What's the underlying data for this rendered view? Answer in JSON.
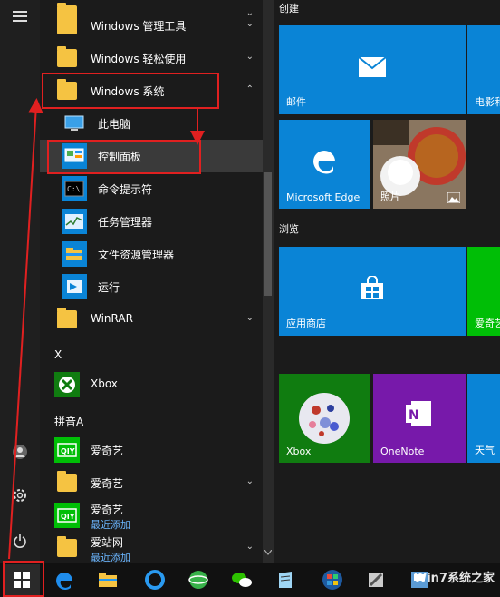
{
  "sections": {
    "x": "X",
    "pinyin_a": "拼音A"
  },
  "apps": {
    "windows_admin_tools": "Windows 管理工具",
    "windows_ease_of_access": "Windows 轻松使用",
    "windows_system": "Windows 系统",
    "this_pc": "此电脑",
    "control_panel": "控制面板",
    "command_prompt": "命令提示符",
    "task_manager": "任务管理器",
    "file_explorer": "文件资源管理器",
    "run": "运行",
    "winrar": "WinRAR",
    "xbox": "Xbox",
    "iqiyi_1": "爱奇艺",
    "iqiyi_2": "爱奇艺",
    "iqiyi_3": "爱奇艺",
    "iqiyi_3_sub": "最近添加",
    "aizhan": "爱站网",
    "aizhan_sub": "最近添加"
  },
  "tiles": {
    "group_create": "创建",
    "group_browse": "浏览",
    "mail": "邮件",
    "movies": "电影和",
    "edge": "Microsoft Edge",
    "photos": "照片",
    "store": "应用商店",
    "aiqi": "爱奇艺",
    "xbox": "Xbox",
    "onenote": "OneNote",
    "weather": "天气"
  },
  "watermark": "Win7系统之家",
  "colors": {
    "accent": "#0a84d6",
    "xbox_green": "#107c10",
    "onenote_purple": "#7719aa",
    "folder": "#f5c342",
    "annotation_red": "#e02020"
  }
}
